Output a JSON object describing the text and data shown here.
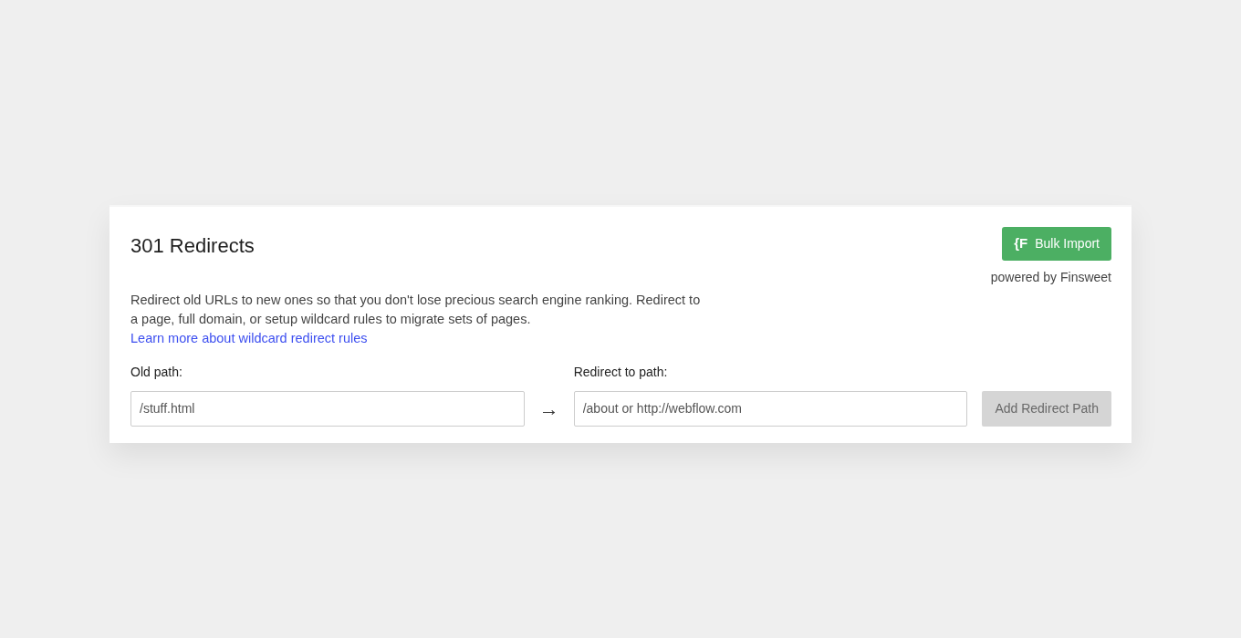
{
  "title": "301 Redirects",
  "bulk_import": {
    "logo": "{F",
    "label": "Bulk Import",
    "powered_by": "powered by Finsweet"
  },
  "description": {
    "text": "Redirect old URLs to new ones so that you don't lose precious search engine ranking. Redirect to a page, full domain, or setup wildcard rules to migrate sets of pages.",
    "link": "Learn more about wildcard redirect rules"
  },
  "old_path": {
    "label": "Old path:",
    "placeholder": "/stuff.html"
  },
  "arrow": "→",
  "redirect_path": {
    "label": "Redirect to path:",
    "placeholder": "/about or http://webflow.com"
  },
  "add_button": {
    "label": "Add Redirect Path",
    "disabled": true
  }
}
